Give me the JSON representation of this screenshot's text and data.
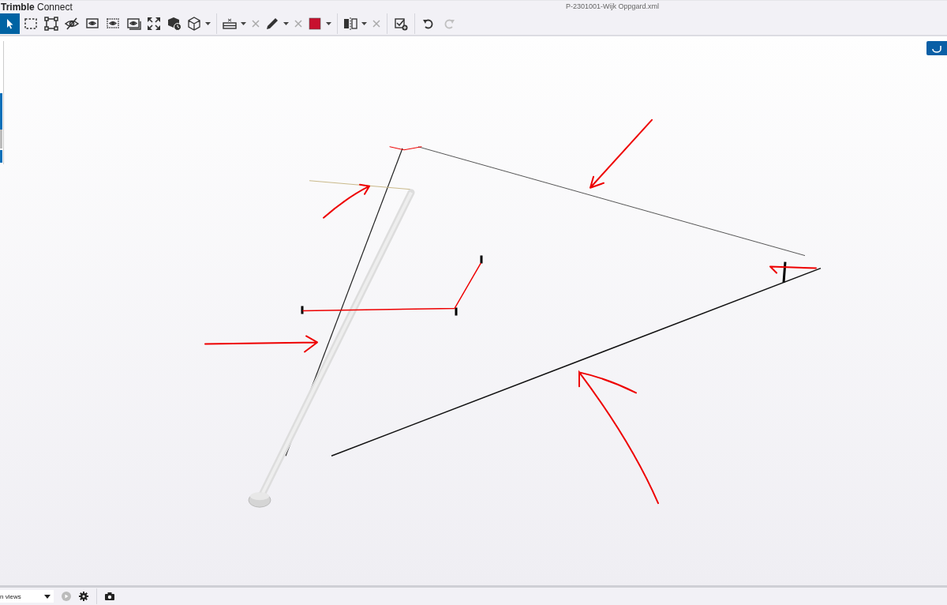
{
  "app": {
    "brand": "Trimble",
    "product": "Connect"
  },
  "file_name": "P-2301001-Wijk Oppgard.xml",
  "toolbar": [
    {
      "selected": true,
      "dropdown": false,
      "disabled": false
    },
    {
      "selected": false,
      "dropdown": false,
      "disabled": false
    },
    {
      "selected": false,
      "dropdown": false,
      "disabled": false
    },
    {
      "selected": false,
      "dropdown": false,
      "disabled": false
    },
    {
      "selected": false,
      "dropdown": false,
      "disabled": false
    },
    {
      "selected": false,
      "dropdown": false,
      "disabled": false
    },
    {
      "selected": false,
      "dropdown": false,
      "disabled": false
    },
    {
      "selected": false,
      "dropdown": false,
      "disabled": false
    },
    {
      "selected": false,
      "dropdown": false,
      "disabled": false
    },
    {
      "selected": false,
      "dropdown": true,
      "disabled": false
    },
    {
      "selected": false,
      "dropdown": true,
      "disabled": false,
      "clear": true,
      "sep_before": true
    },
    {
      "selected": false,
      "dropdown": true,
      "disabled": false,
      "clear": true
    },
    {
      "selected": false,
      "dropdown": true,
      "disabled": false,
      "color": "#c8102e"
    },
    {
      "selected": false,
      "dropdown": true,
      "disabled": false,
      "clear": true,
      "sep_before": true
    },
    {
      "selected": false,
      "dropdown": false,
      "disabled": false,
      "sep_before": true
    },
    {
      "selected": false,
      "dropdown": false,
      "disabled": false,
      "sep_before": true
    },
    {
      "selected": false,
      "dropdown": false,
      "disabled": true
    }
  ],
  "views_select": {
    "value": "n views"
  }
}
